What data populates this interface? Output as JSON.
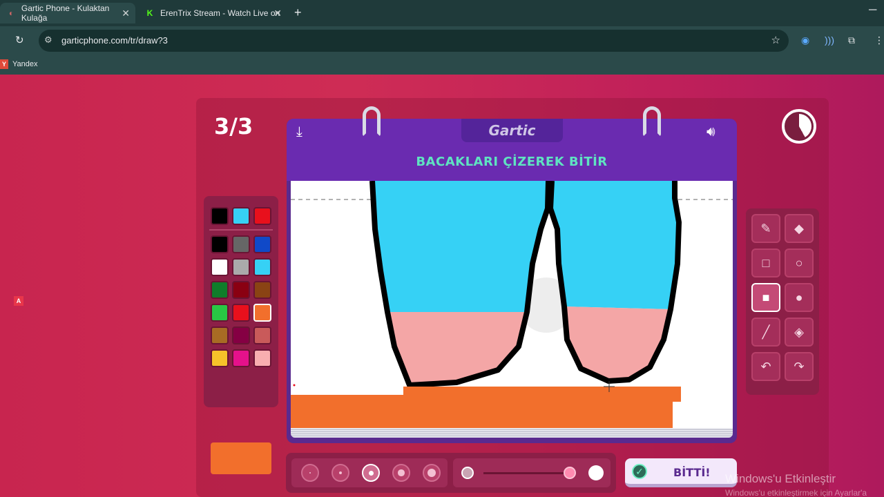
{
  "browser": {
    "tabs": [
      {
        "title": "Gartic Phone - Kulaktan Kulağa",
        "favicon": "gartic-favicon",
        "active": true
      },
      {
        "title": "ErenTrix Stream - Watch Live on",
        "favicon": "kick-favicon",
        "active": false
      }
    ],
    "new_tab": "+",
    "url": "garticphone.com/tr/draw?3",
    "bookmarks": [
      {
        "label": "Yandex",
        "icon": "Y"
      }
    ]
  },
  "game": {
    "round": "3/3",
    "side_marker": "A",
    "timer_remaining_fraction": 0.42,
    "logo": "Gartic",
    "instruction": "BACAKLARI ÇİZEREK BİTİR",
    "done_label": "BİTTİ!",
    "palette": {
      "top_row": [
        "#000000",
        "#36d1f5",
        "#e8101c"
      ],
      "grid": [
        [
          "#000000",
          "#666666",
          "#1049c8"
        ],
        [
          "#ffffff",
          "#aaaaaa",
          "#36d1f5"
        ],
        [
          "#0f7d2a",
          "#8a0012",
          "#8a4314"
        ],
        [
          "#29c744",
          "#e8101c",
          "#f26f2c"
        ],
        [
          "#a86b24",
          "#850043",
          "#c95a5a"
        ],
        [
          "#f6c22a",
          "#e5118b",
          "#f8aeb0"
        ]
      ],
      "selected": "#f26f2c"
    },
    "tools": [
      "pencil-icon",
      "eraser-icon",
      "rectangle-outline-icon",
      "ellipse-outline-icon",
      "rectangle-filled-icon",
      "ellipse-filled-icon",
      "line-icon",
      "fill-bucket-icon",
      "undo-icon",
      "redo-icon"
    ],
    "selected_tool": "rectangle-filled-icon",
    "brush_sizes": 5,
    "selected_size_index": 2,
    "opacity_fraction": 0.95
  },
  "os_watermark": {
    "line1": "Windows'u Etkinleştir",
    "line2": "Windows'u etkinleştirmek için Ayarlar'a"
  }
}
